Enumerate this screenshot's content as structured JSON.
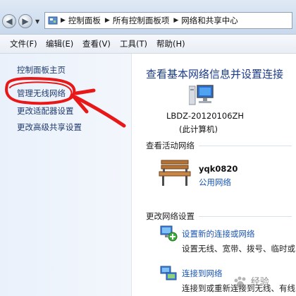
{
  "address_bar": {
    "segments": [
      "控制面板",
      "所有控制面板项",
      "网络和共享中心"
    ]
  },
  "menu": {
    "items": [
      "文件(F)",
      "编辑(E)",
      "查看(V)",
      "工具(T)",
      "帮助(H)"
    ]
  },
  "sidebar": {
    "items": [
      "控制面板主页",
      "管理无线网络",
      "更改适配器设置",
      "更改高级共享设置"
    ]
  },
  "main": {
    "heading": "查看基本网络信息并设置连接",
    "computer": {
      "name": "LBDZ-20120106ZH",
      "sub": "(此计算机)"
    },
    "active_networks": {
      "title": "查看活动网络",
      "network_name": "yqk0820",
      "network_type": "公用网络"
    },
    "change_settings": {
      "title": "更改网络设置",
      "items": [
        {
          "title": "设置新的连接或网络",
          "desc": "设置无线、宽带、拨号、临时或"
        },
        {
          "title": "连接到网络",
          "desc": "连接到或重新连接到无线、有线"
        }
      ]
    }
  },
  "watermark": "经验",
  "colors": {
    "link": "#1a55b5",
    "heading": "#1a3a8a",
    "annotation": "#e81818",
    "sidebar_bg": "#eaf1fb"
  }
}
